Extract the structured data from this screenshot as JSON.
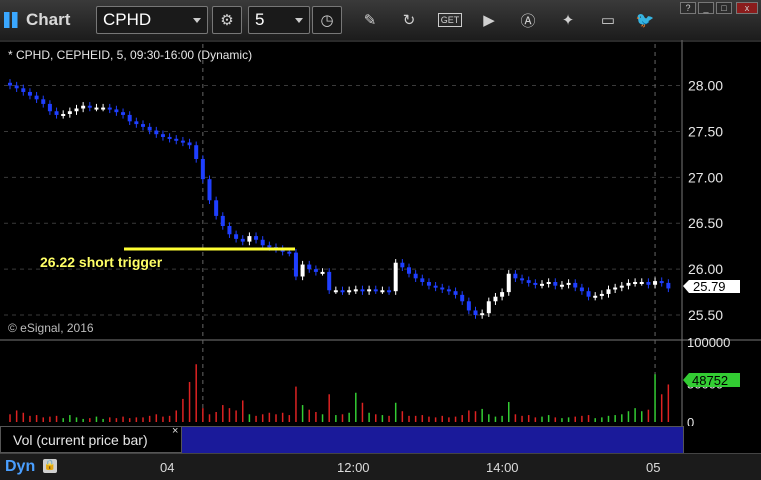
{
  "toolbar": {
    "app_title": "Chart",
    "symbol": "CPHD",
    "interval": "5",
    "buttons": [
      "settings-icon",
      "clock-icon",
      "pencil-icon",
      "refresh-icon",
      "get-icon",
      "play-icon",
      "alert-icon",
      "tools-icon",
      "chat-icon",
      "twitter-icon"
    ],
    "window_controls": [
      "?",
      "_",
      "□",
      "x"
    ]
  },
  "chart_header": "* CPHD, CEPHEID, 5, 09:30-16:00 (Dynamic)",
  "watermark": "© eSignal, 2016",
  "annotation": {
    "text": "26.22 short trigger",
    "level": 26.22,
    "color": "#ffff33"
  },
  "price_badge": "25.79",
  "volume_badge": "48752",
  "volume_label": "Vol (current price bar)",
  "close_x": "×",
  "status": {
    "mode": "Dyn"
  },
  "time_labels": [
    "04",
    "12:00",
    "14:00",
    "05"
  ],
  "colors": {
    "up": "#ffffff",
    "down": "#1f3fff",
    "vol_up": "#33cc33",
    "vol_down": "#dd2222",
    "grid": "#3a3a3a",
    "badge_vol": "#33cc33",
    "panel": "#1a1a9a"
  },
  "chart_data": {
    "type": "candlestick",
    "title": "* CPHD, CEPHEID, 5, 09:30-16:00 (Dynamic)",
    "price_axis": {
      "ticks": [
        25.5,
        26.0,
        26.5,
        27.0,
        27.5,
        28.0
      ],
      "tick_labels": [
        "25.50",
        "26.00",
        "26.50",
        "27.00",
        "27.50",
        "28.00"
      ],
      "range": [
        25.25,
        28.3
      ]
    },
    "volume_axis": {
      "tick_labels": [
        "100000",
        "50000",
        "0"
      ],
      "range": [
        0,
        100000
      ]
    },
    "last_price": 25.79,
    "last_volume": 48752,
    "closes": [
      28.0,
      27.97,
      27.93,
      27.89,
      27.85,
      27.8,
      27.72,
      27.68,
      27.69,
      27.72,
      27.75,
      27.78,
      27.76,
      27.76,
      27.76,
      27.74,
      27.71,
      27.68,
      27.61,
      27.58,
      27.55,
      27.51,
      27.47,
      27.44,
      27.42,
      27.4,
      27.38,
      27.35,
      27.2,
      26.98,
      26.75,
      26.58,
      26.47,
      26.38,
      26.33,
      26.3,
      26.36,
      26.32,
      26.26,
      26.24,
      26.22,
      26.19,
      26.18,
      25.92,
      26.05,
      26.0,
      25.97,
      25.97,
      25.77,
      25.77,
      25.76,
      25.77,
      25.78,
      25.76,
      25.78,
      25.77,
      25.77,
      25.76,
      26.07,
      26.02,
      25.95,
      25.9,
      25.86,
      25.82,
      25.8,
      25.78,
      25.76,
      25.72,
      25.65,
      25.55,
      25.5,
      25.52,
      25.65,
      25.7,
      25.75,
      25.95,
      25.9,
      25.88,
      25.85,
      25.83,
      25.84,
      25.86,
      25.82,
      25.83,
      25.85,
      25.8,
      25.76,
      25.7,
      25.71,
      25.73,
      25.78,
      25.8,
      25.82,
      25.85,
      25.86,
      25.86,
      25.83,
      25.87,
      25.85,
      25.79
    ],
    "volumes": [
      10000,
      15000,
      12000,
      8000,
      9000,
      6000,
      7000,
      8000,
      5000,
      9000,
      6000,
      4000,
      5000,
      7000,
      4000,
      6000,
      5000,
      7000,
      5000,
      6000,
      6000,
      8000,
      10000,
      7000,
      8000,
      15000,
      30000,
      52000,
      75000,
      18000,
      10000,
      13000,
      22000,
      18000,
      15000,
      28000,
      10000,
      8000,
      10000,
      12000,
      10000,
      12000,
      9000,
      46000,
      22000,
      16000,
      13000,
      10000,
      36000,
      9000,
      10000,
      12000,
      38000,
      25000,
      12000,
      10000,
      9000,
      8000,
      25000,
      14000,
      8000,
      8000,
      9000,
      7000,
      6000,
      8000,
      6000,
      7000,
      9000,
      15000,
      14000,
      17000,
      10000,
      7000,
      8000,
      26000,
      10000,
      8000,
      9000,
      6000,
      7000,
      9000,
      6000,
      5000,
      6000,
      7000,
      8000,
      9000,
      5000,
      6000,
      8000,
      9000,
      10000,
      14000,
      18000,
      14000,
      16000,
      62000,
      36000,
      48752
    ],
    "marker_sessions": [
      "04",
      "05"
    ]
  }
}
